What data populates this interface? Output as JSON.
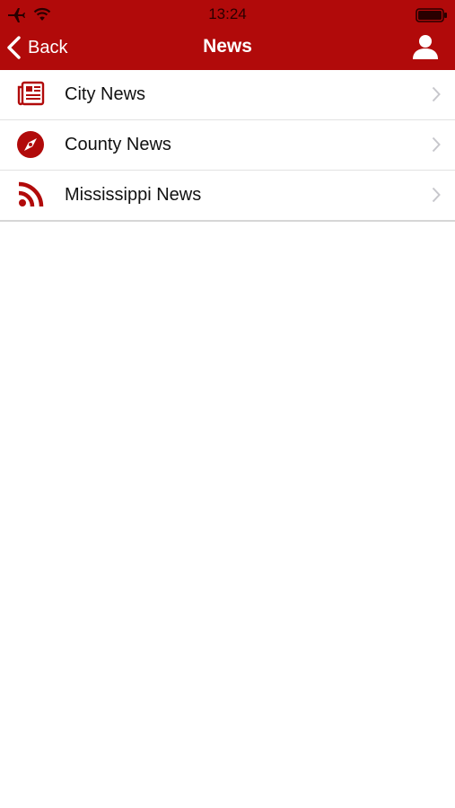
{
  "status_bar": {
    "time": "13:24",
    "icons": [
      "airplane-icon",
      "wifi-icon",
      "battery-icon"
    ]
  },
  "nav": {
    "back_label": "Back",
    "title": "News",
    "right_icon": "user-icon"
  },
  "colors": {
    "brand": "#b10a0a",
    "text": "#111111",
    "chevron": "#c7c7cc",
    "separator": "#e2e2e2"
  },
  "list": {
    "items": [
      {
        "label": "City News",
        "icon": "newspaper-icon"
      },
      {
        "label": "County News",
        "icon": "compass-icon"
      },
      {
        "label": "Mississippi News",
        "icon": "rss-icon"
      }
    ]
  }
}
